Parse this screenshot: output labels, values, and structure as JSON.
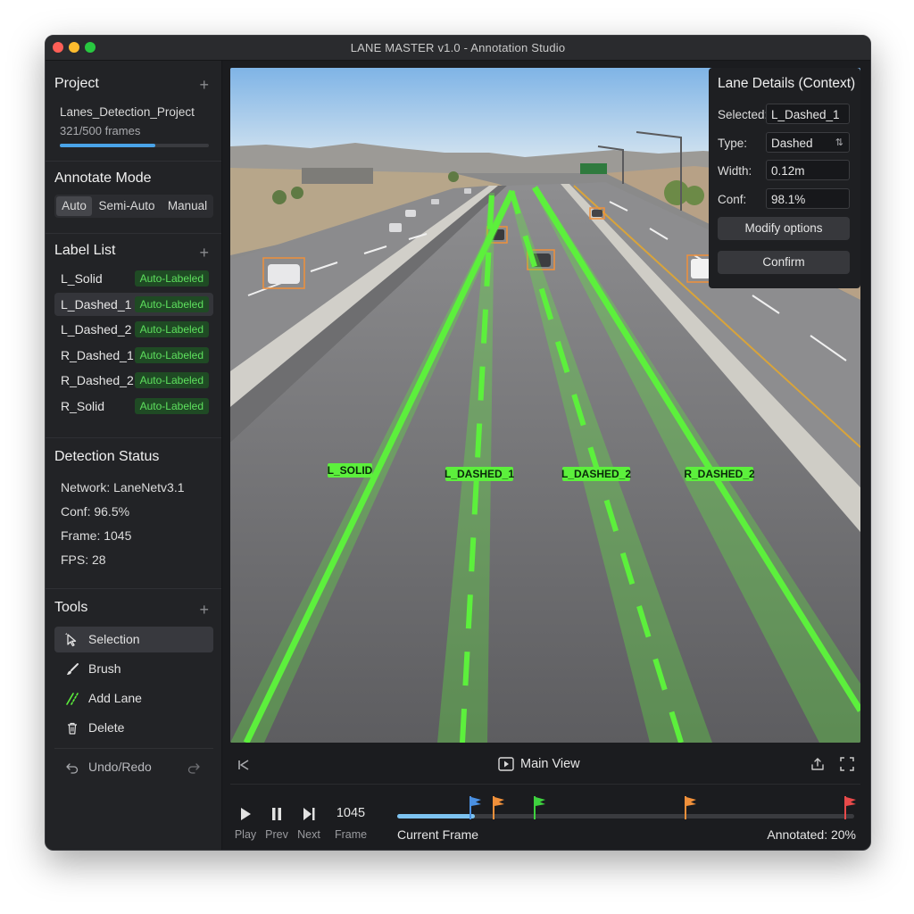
{
  "window": {
    "title": "LANE MASTER v1.0 - Annotation Studio"
  },
  "project": {
    "heading": "Project",
    "name": "Lanes_Detection_Project",
    "frames": "321/500 frames",
    "progress": 0.642
  },
  "annotate_mode": {
    "heading": "Annotate Mode",
    "options": [
      "Auto",
      "Semi-Auto",
      "Manual"
    ],
    "selected": "Auto"
  },
  "label_list": {
    "heading": "Label List",
    "items": [
      {
        "name": "L_Solid",
        "badge": "Auto-Labeled"
      },
      {
        "name": "L_Dashed_1",
        "badge": "Auto-Labeled",
        "selected": true
      },
      {
        "name": "L_Dashed_2",
        "badge": "Auto-Labeled"
      },
      {
        "name": "R_Dashed_1",
        "badge": "Auto-Labeled"
      },
      {
        "name": "R_Dashed_2",
        "badge": "Auto-Labeled"
      },
      {
        "name": "R_Solid",
        "badge": "Auto-Labeled"
      }
    ]
  },
  "detection_status": {
    "heading": "Detection Status",
    "network": "Network: LaneNetv3.1",
    "conf": "Conf: 96.5%",
    "frame": "Frame: 1045",
    "fps": "FPS: 28"
  },
  "tools": {
    "heading": "Tools",
    "items": [
      "Selection",
      "Brush",
      "Add Lane",
      "Delete"
    ],
    "selected": "Selection",
    "undo_redo": "Undo/Redo"
  },
  "lane_details": {
    "title": "Lane Details (Context)",
    "selected_key": "Selected:",
    "selected_value": "L_Dashed_1",
    "type_key": "Type:",
    "type_value": "Dashed",
    "width_key": "Width:",
    "width_value": "0.12m",
    "conf_key": "Conf:",
    "conf_value": "98.1%",
    "modify_button": "Modify options",
    "confirm_button": "Confirm"
  },
  "lane_labels": [
    "L_SOLID",
    "L_DASHED_1",
    "L_DASHED_2",
    "R_DASHED_2"
  ],
  "view": {
    "label": "Main View"
  },
  "transport": {
    "play": "Play",
    "prev": "Prev",
    "next": "Next",
    "frame_number": "1045",
    "frame_caption": "Frame",
    "current_frame": "Current Frame",
    "annotated": "Annotated: 20%",
    "timeline_progress": 0.17,
    "markers": [
      {
        "position": 0.16,
        "color": "#4a90e2"
      },
      {
        "position": 0.21,
        "color": "#f0903a"
      },
      {
        "position": 0.3,
        "color": "#3ed13e"
      },
      {
        "position": 0.63,
        "color": "#f0903a"
      },
      {
        "position": 0.98,
        "color": "#e84a4a"
      }
    ]
  },
  "colors": {
    "lane_green": "#5cf03c",
    "accent_blue": "#4aa3e8",
    "badge_green": "#5ee05e"
  }
}
